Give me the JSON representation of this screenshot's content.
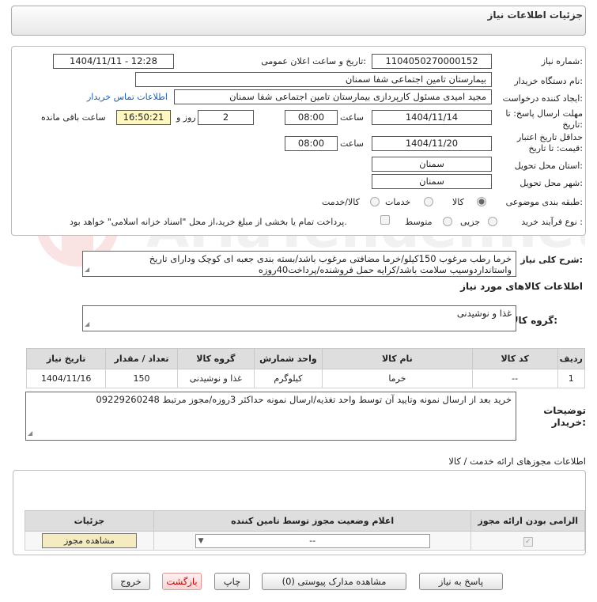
{
  "header": {
    "title": "جزئیات اطلاعات نیاز"
  },
  "form": {
    "need_number_label": "شماره نیاز:",
    "need_number": "1104050270000152",
    "announce_label": "تاریخ و ساعت اعلان عمومی:",
    "announce_value": "1404/11/11 - 12:28",
    "buyer_label": "نام دستگاه خریدار:",
    "buyer_value": "بیمارستان تامین اجتماعی شفا سمنان",
    "creator_label": "ایجاد کننده درخواست:",
    "creator_value": "مجید امیدی مسئول کارپردازی بیمارستان تامین اجتماعی شفا سمنان",
    "contact_link": "اطلاعات تماس خریدار",
    "deadline_label_1": "مهلت ارسال پاسخ: تا",
    "deadline_label_2": "تاریخ:",
    "deadline_date": "1404/11/14",
    "time_label": "ساعت",
    "deadline_time": "08:00",
    "days_value": "2",
    "days_label": "روز و",
    "remaining_time": "16:50:21",
    "remaining_label": "ساعت باقی مانده",
    "validity_label_1": "حداقل تاریخ اعتبار",
    "validity_label_2": "قیمت: تا تاریخ:",
    "validity_date": "1404/11/20",
    "validity_time": "08:00",
    "province_label": "استان محل تحویل:",
    "province_value": "سمنان",
    "city_label": "شهر محل تحویل:",
    "city_value": "سمنان",
    "category_label": "طبقه بندی موضوعی:",
    "category_options": [
      "کالا",
      "خدمات",
      "کالا/خدمت"
    ],
    "category_selected": "کالا",
    "process_label": "نوع فرآیند خرید :",
    "process_options": [
      "جزیی",
      "متوسط"
    ],
    "process_selected": "جزیی",
    "payment_text": "پرداخت تمام یا بخشی از مبلغ خرید،از محل \"اسناد خزانه اسلامی\" خواهد بود."
  },
  "description": {
    "label": "شرح کلی نیاز:",
    "text": "خرما رطب مرغوب 150کیلو/خرما مضافتی مرغوب باشد/بسته بندی جعبه ای کوچک ودارای تاریخ واستانداردوسیب سلامت باشد/کرایه حمل فروشنده/پرداخت40روزه"
  },
  "goods": {
    "section_title": "اطلاعات کالاهای مورد نیاز",
    "group_label": "گروه کالا:",
    "group_value": "غذا و نوشیدنی",
    "columns": [
      "ردیف",
      "کد کالا",
      "نام کالا",
      "واحد شمارش",
      "گروه کالا",
      "تعداد / مقدار",
      "تاریخ نیاز"
    ],
    "rows": [
      [
        "1",
        "--",
        "خرما",
        "کیلوگرم",
        "غذا و نوشیدنی",
        "150",
        "1404/11/16"
      ]
    ]
  },
  "buyer_notes": {
    "label_1": "توضیحات",
    "label_2": "خریدار:",
    "text": "خرید بعد از ارسال نمونه وتایید آن توسط واحد تغذیه/ارسال نمونه حداکثر 3روزه/مجوز مرتبط     09229260248"
  },
  "permits": {
    "section_title": "اطلاعات مجوزهای ارائه خدمت / کالا",
    "columns": [
      "الزامی بودن ارائه مجوز",
      "اعلام وضعیت مجوز توسط تامین کننده",
      "جزئیات"
    ],
    "select_value": "--",
    "view_button": "مشاهده مجوز"
  },
  "footer": {
    "reply_button": "پاسخ به نیاز",
    "attachments_button": "مشاهده مدارک پیوستی (0)",
    "print_button": "چاپ",
    "back_button": "بازگشت",
    "exit_button": "خروج"
  },
  "watermark": {
    "text": "AriaTender.net"
  },
  "colors": {
    "link": "#1a5fb4",
    "highlight": "#fff7c2",
    "exit": "#cc0000"
  }
}
